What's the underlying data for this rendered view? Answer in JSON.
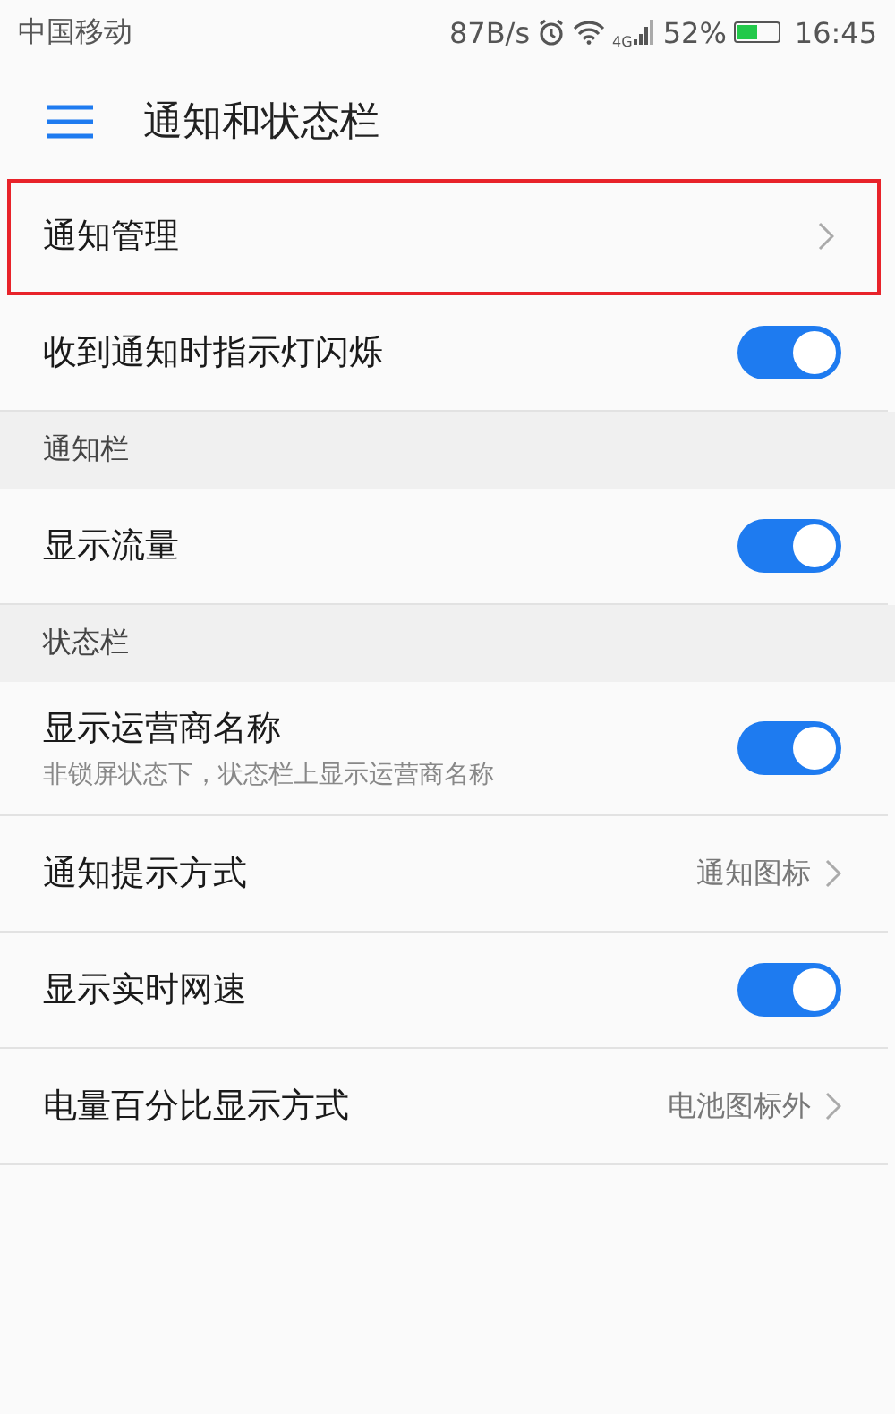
{
  "status_bar": {
    "carrier": "中国移动",
    "speed": "87B/s",
    "network": "4G",
    "battery": "52%",
    "time": "16:45"
  },
  "header": {
    "title": "通知和状态栏"
  },
  "sections": [
    {
      "items": [
        {
          "kind": "link",
          "label": "通知管理",
          "highlighted": true
        },
        {
          "kind": "toggle",
          "label": "收到通知时指示灯闪烁",
          "on": true,
          "highlighted": false
        }
      ]
    },
    {
      "title": "通知栏",
      "items": [
        {
          "kind": "toggle",
          "label": "显示流量",
          "on": true,
          "highlighted": false
        }
      ]
    },
    {
      "title": "状态栏",
      "items": [
        {
          "kind": "toggle",
          "label": "显示运营商名称",
          "subtitle": "非锁屏状态下，状态栏上显示运营商名称",
          "on": true,
          "highlighted": false
        },
        {
          "kind": "link",
          "label": "通知提示方式",
          "value": "通知图标",
          "highlighted": false
        },
        {
          "kind": "toggle",
          "label": "显示实时网速",
          "on": true,
          "highlighted": false
        },
        {
          "kind": "link",
          "label": "电量百分比显示方式",
          "value": "电池图标外",
          "highlighted": false
        }
      ]
    }
  ]
}
